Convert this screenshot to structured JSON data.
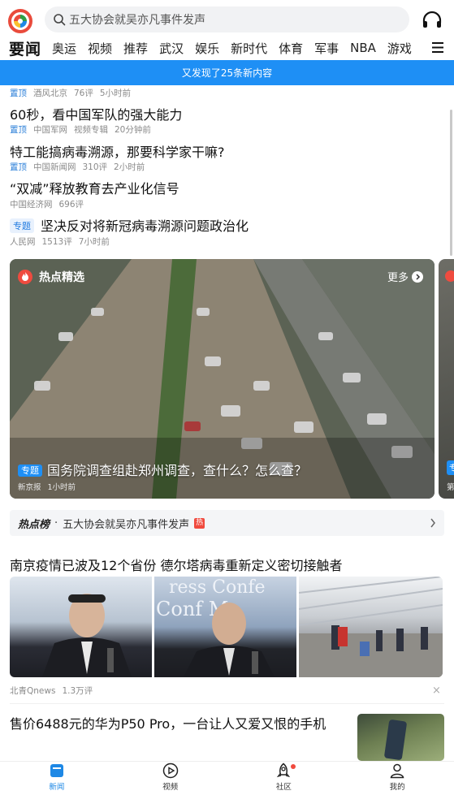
{
  "header": {
    "search_placeholder": "五大协会就吴亦凡事件发声",
    "channels": [
      "要闻",
      "奥运",
      "视频",
      "推荐",
      "武汉",
      "娱乐",
      "新时代",
      "体育",
      "军事",
      "NBA",
      "游戏"
    ]
  },
  "banner": {
    "text": "又发现了25条新内容"
  },
  "news": [
    {
      "title": "",
      "pin": "置顶",
      "source": "酒风北京",
      "comments": "76评",
      "time": "5小时前"
    },
    {
      "title": "60秒，看中国军队的强大能力",
      "pin": "置顶",
      "source": "中国军网",
      "comments": "视频专辑",
      "time": "20分钟前"
    },
    {
      "title": "特工能搞病毒溯源，那要科学家干嘛?",
      "pin": "置顶",
      "source": "中国新闻网",
      "comments": "310评",
      "time": "2小时前"
    },
    {
      "title": "“双减”释放教育去产业化信号",
      "pin": "",
      "source": "中国经济网",
      "comments": "696评",
      "time": ""
    },
    {
      "title": "坚决反对将新冠病毒溯源问题政治化",
      "tag": "专题",
      "source": "人民网",
      "comments": "1513评",
      "time": "7小时前"
    }
  ],
  "hot_picks": {
    "label": "热点精选",
    "more": "更多",
    "tag": "专题",
    "caption": "国务院调查组赴郑州调查，查什么？怎么查？",
    "source": "新京报",
    "time": "1小时前",
    "next_tag": "专",
    "next_source": "第"
  },
  "hot_list": {
    "label": "热点榜",
    "dot": "·",
    "text": "五大协会就吴亦凡事件发声",
    "badge": "热"
  },
  "article_images": {
    "title": "南京疫情已波及12个省份 德尔塔病毒重新定义密切接触者",
    "photo2_text1": "ress Confe",
    "photo2_text2": "Conf   Me",
    "source": "北青Qnews",
    "comments": "1.3万评",
    "close": "×"
  },
  "article_thumb": {
    "title": "售价6488元的华为P50 Pro，一台让人又爱又恨的手机"
  },
  "bottom_nav": [
    {
      "label": "新闻",
      "active": true
    },
    {
      "label": "视频",
      "active": false
    },
    {
      "label": "社区",
      "active": false
    },
    {
      "label": "我的",
      "active": false
    }
  ],
  "colors": {
    "accent": "#1e8ff5",
    "pin": "#2b7fd8",
    "hot": "#f04a3e"
  }
}
